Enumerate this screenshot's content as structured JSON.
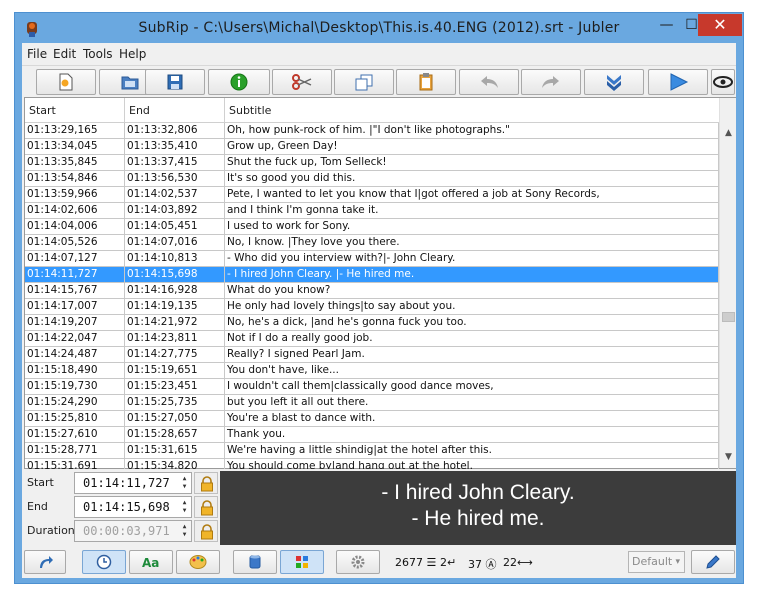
{
  "window": {
    "title": "SubRip - C:\\Users\\Michal\\Desktop\\This.is.40.ENG (2012).srt - Jubler",
    "min_label": "—",
    "max_label": "☐",
    "close_label": "✕"
  },
  "menu": [
    "File",
    "Edit",
    "Tools",
    "Help"
  ],
  "toolbar": {
    "buttons": [
      "new-file",
      "open-file",
      "save-file",
      "info",
      "cut",
      "copy",
      "paste",
      "undo",
      "redo",
      "play-down",
      "play",
      "preview-eye"
    ]
  },
  "table": {
    "headers": [
      "Start",
      "End",
      "Subtitle"
    ],
    "rows": [
      [
        "01:13:29,165",
        "01:13:32,806",
        "Oh, how punk-rock of him. |\"I don't like photographs.\""
      ],
      [
        "01:13:34,045",
        "01:13:35,410",
        "Grow up, Green Day!"
      ],
      [
        "01:13:35,845",
        "01:13:37,415",
        "Shut the fuck up, Tom Selleck!"
      ],
      [
        "01:13:54,846",
        "01:13:56,530",
        "It's so good you did this."
      ],
      [
        "01:13:59,966",
        "01:14:02,537",
        "Pete, I wanted to let you know that I|got offered a job at Sony Records,"
      ],
      [
        "01:14:02,606",
        "01:14:03,892",
        "and I think I'm gonna take it."
      ],
      [
        "01:14:04,006",
        "01:14:05,451",
        "I used to work for Sony."
      ],
      [
        "01:14:05,526",
        "01:14:07,016",
        "No, I know. |They love you there."
      ],
      [
        "01:14:07,127",
        "01:14:10,813",
        "- Who did you interview with?|- John Cleary."
      ],
      [
        "01:14:11,727",
        "01:14:15,698",
        "- I hired John Cleary. |- He hired me."
      ],
      [
        "01:14:15,767",
        "01:14:16,928",
        "What do you know?"
      ],
      [
        "01:14:17,007",
        "01:14:19,135",
        "He only had lovely things|to say about you."
      ],
      [
        "01:14:19,207",
        "01:14:21,972",
        "No, he's a dick, |and he's gonna fuck you too."
      ],
      [
        "01:14:22,047",
        "01:14:23,811",
        "Not if I do a really good job."
      ],
      [
        "01:14:24,487",
        "01:14:27,775",
        "Really? I signed Pearl Jam."
      ],
      [
        "01:15:18,490",
        "01:15:19,651",
        "You don't have, like..."
      ],
      [
        "01:15:19,730",
        "01:15:23,451",
        "I wouldn't call them|classically good dance moves,"
      ],
      [
        "01:15:24,290",
        "01:15:25,735",
        "but you left it all out there."
      ],
      [
        "01:15:25,810",
        "01:15:27,050",
        "You're a blast to dance with."
      ],
      [
        "01:15:27,610",
        "01:15:28,657",
        "Thank you."
      ],
      [
        "01:15:28,771",
        "01:15:31,615",
        "We're having a little shindig|at the hotel after this."
      ],
      [
        "01:15:31,691",
        "01:15:34,820",
        "You should come by|and hang out at the hotel."
      ]
    ],
    "selected_index": 9
  },
  "editor": {
    "start_label": "Start",
    "start_value": "01:14:11,727",
    "end_label": "End",
    "end_value": "01:14:15,698",
    "duration_label": "Duration",
    "duration_value": "00:00:03,971",
    "preview_line1": "- I hired John Cleary.",
    "preview_line2": "- He hired me."
  },
  "status": {
    "chars": "2677",
    "lines": "2",
    "cps": "37",
    "width": "22",
    "style_value": "Default"
  },
  "colors": {
    "selection": "#3399ff",
    "titlebar": "#6aa8e0",
    "close": "#c7392c",
    "preview_bg": "#3c3c3c"
  }
}
